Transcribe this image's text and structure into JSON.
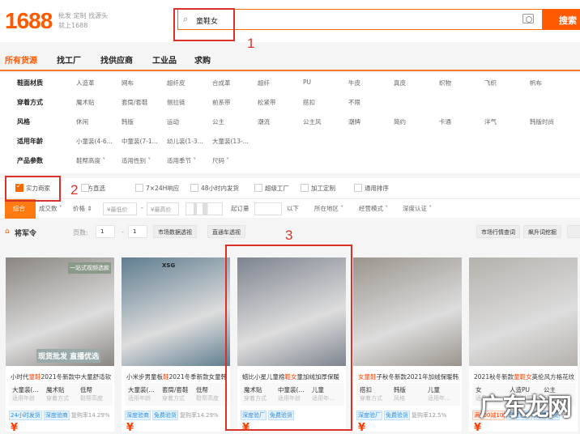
{
  "header": {
    "logo": "1688",
    "slogan1": "批发 定制 找源头",
    "slogan2": "就上1688",
    "search_value": "童鞋女",
    "search_button": "搜索"
  },
  "nav": [
    "所有货源",
    "找工厂",
    "找供应商",
    "工业品",
    "求购"
  ],
  "filters": [
    {
      "label": "鞋面材质",
      "options": [
        "人造革",
        "网布",
        "超纤皮",
        "合成革",
        "超纤",
        "PU",
        "牛皮",
        "真皮",
        "织物",
        "飞织",
        "帆布"
      ]
    },
    {
      "label": "穿着方式",
      "options": [
        "魔术贴",
        "套筒/套鞋",
        "侧拉链",
        "前系带",
        "松紧带",
        "搭扣",
        "不限"
      ]
    },
    {
      "label": "风格",
      "options": [
        "休闲",
        "韩版",
        "运动",
        "公主",
        "潮流",
        "公主风",
        "潮牌",
        "简约",
        "卡通",
        "洋气",
        "韩版时尚"
      ]
    },
    {
      "label": "适用年龄",
      "options": [
        "小童装(4-6...",
        "中童装(7-1...",
        "幼儿装(1-3...",
        "大童装(13-..."
      ]
    },
    {
      "label": "产品参数",
      "options": [
        "鞋帮高度",
        "适用性别",
        "适用季节",
        "尺码"
      ]
    }
  ],
  "checks": [
    {
      "label": "实力商家",
      "checked": true
    },
    {
      "label": "官方直选",
      "checked": false
    },
    {
      "label": "7×24H响应",
      "checked": false
    },
    {
      "label": "48小时内发货",
      "checked": false
    },
    {
      "label": "超级工厂",
      "checked": false
    },
    {
      "label": "加工定制",
      "checked": false
    },
    {
      "label": "通用排序",
      "checked": false
    }
  ],
  "sort": {
    "comprehensive": "综合",
    "sales": "成交数",
    "price": "价格",
    "min_price": "¥最低价",
    "dash": "-",
    "max_price": "¥最高价",
    "moq": "起订量",
    "below": "以下",
    "region": "所在地区",
    "business": "经营模式",
    "cert": "深度认证"
  },
  "jjl": {
    "title": "将军令",
    "pages_label": "页数:",
    "page_from": "1",
    "dash": "-",
    "page_to": "1",
    "btn1": "市场数据透视",
    "btn2": "直通车透视",
    "btn3": "市场行情查词",
    "btn4": "飙升词挖掘"
  },
  "annotations": [
    "1",
    "2",
    "3"
  ],
  "watermark": "广东龙网",
  "products": [
    {
      "overlay_top": "一站式视频选款",
      "overlay_bottom": "现货批发 直播优选",
      "title_pre": "小时代",
      "title_hl": "童鞋",
      "title_post": "2021冬新款中大童舒适软",
      "attrs": [
        [
          "大童装(...",
          "适用年龄"
        ],
        [
          "魔术贴",
          "穿着方式"
        ],
        [
          "低帮",
          "鞋帮高度"
        ]
      ],
      "tags": [
        "24小时发货",
        "深度验商"
      ],
      "tag_colors": [
        "blue",
        "blue"
      ],
      "repurchase": "复购率14.29%",
      "bg": "#8a8580"
    },
    {
      "overlay_top": "XSG",
      "title_pre": "小米步男童板",
      "title_hl": "鞋",
      "title_post": "2021冬季新款女童韩",
      "attrs": [
        [
          "大童装(...",
          "适用年龄"
        ],
        [
          "套筒/套鞋",
          "穿着方式"
        ],
        [
          "低帮",
          "鞋帮高度"
        ]
      ],
      "tags": [
        "深度验商",
        "免费验货"
      ],
      "tag_colors": [
        "blue",
        "blue"
      ],
      "repurchase": "复购率14.29%",
      "bg": "#5f7d8f"
    },
    {
      "title_pre": "蜡比小星儿童棉",
      "title_hl": "鞋女",
      "title_post": "童加绒加厚保暖",
      "attrs": [
        [
          "魔术贴",
          "穿着方式"
        ],
        [
          "中童装(...",
          "适用年龄"
        ],
        [
          "儿童",
          "适用年..."
        ]
      ],
      "tags": [
        "深度验厂",
        "免费验货"
      ],
      "tag_colors": [
        "blue",
        "blue"
      ],
      "repurchase": "",
      "bg": "#7d848f"
    },
    {
      "title_pre": "",
      "title_hl": "女童鞋",
      "title_post": "子秋冬新款2021年加绒保暖韩",
      "attrs": [
        [
          "搭扣",
          "穿着方式"
        ],
        [
          "韩版",
          "风格"
        ],
        [
          "儿童",
          "适用年..."
        ]
      ],
      "tags": [
        "深度验厂",
        "免费验货"
      ],
      "tag_colors": [
        "blue",
        "blue"
      ],
      "repurchase": "复购率12.5%",
      "bg": "#9a948c"
    },
    {
      "title_pre": "2021秋冬新款",
      "title_hl": "童鞋女",
      "title_post": "英伦风方格花纹",
      "attrs": [
        [
          "女",
          "适用性别"
        ],
        [
          "人造PU",
          "鞋面材质"
        ],
        [
          "公主",
          "风格"
        ]
      ],
      "tags": [
        "满100减10",
        "深度验厂",
        "免费验货"
      ],
      "tag_colors": [
        "red",
        "blue",
        "blue"
      ],
      "repurchase": "",
      "bg": "#b5b1ac"
    }
  ]
}
